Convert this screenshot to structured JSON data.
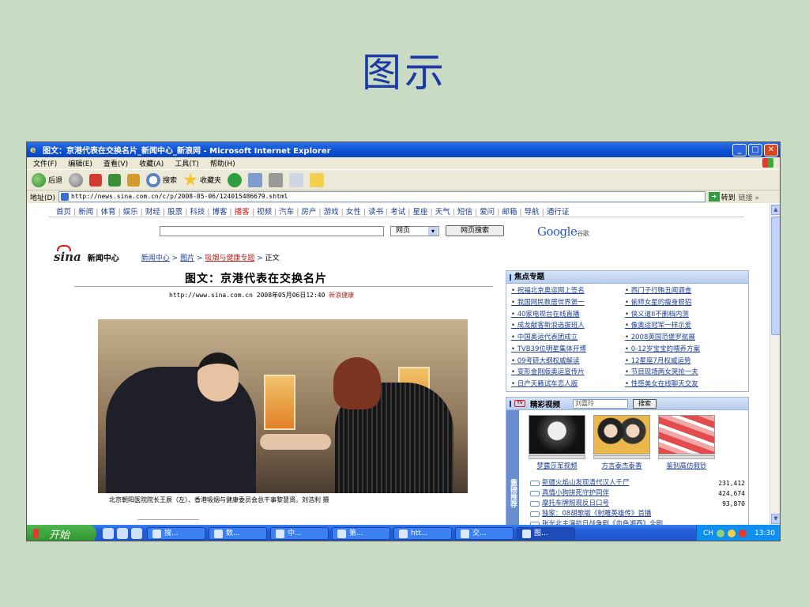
{
  "slide": {
    "title": "图示"
  },
  "window": {
    "title": "图文：京港代表在交换名片_新闻中心_新浪网 - Microsoft Internet Explorer",
    "minimize": "_",
    "maximize": "□",
    "close": "✕"
  },
  "menu": [
    "文件(F)",
    "编辑(E)",
    "查看(V)",
    "收藏(A)",
    "工具(T)",
    "帮助(H)"
  ],
  "toolbar": {
    "back": "后退",
    "search": "搜索",
    "favorites": "收藏夹"
  },
  "address": {
    "label": "地址(D)",
    "url": "http://news.sina.com.cn/c/p/2008-05-06/124015486679.shtml",
    "go": "转到",
    "links": "链接 »"
  },
  "site": {
    "nav": [
      "首页",
      "新闻",
      "体育",
      "娱乐",
      "财经",
      "股票",
      "科技",
      "博客",
      "播客",
      "视频",
      "汽车",
      "房产",
      "游戏",
      "女性",
      "读书",
      "考试",
      "星座",
      "天气",
      "短信",
      "爱问",
      "邮箱",
      "导航",
      "通行证"
    ],
    "hot_nav": "播客",
    "search_select": "网页",
    "search_button": "网页搜索",
    "google": "Google",
    "google_cn": "谷歌",
    "logo": "sina",
    "channel": "新闻中心",
    "breadcrumb": {
      "home": "新闻中心",
      "sep1": " > ",
      "section": "图片",
      "sep2": " > ",
      "topic": "吸烟与健康专题",
      "sep3": " > ",
      "current": "正文"
    }
  },
  "article": {
    "title": "图文：京港代表在交换名片",
    "url": "http://www.sina.com.cn",
    "date": "2008年05月06日12:40",
    "source": "新浪健康",
    "caption": "北京朝阳医院院长王辰（左）、香港吸烟与健康委员会总干事黎慧贤。刘浩利 摄"
  },
  "focus": {
    "header": "焦点专题",
    "items": [
      "祝福北京奥运网上签名",
      "西门子行贿丑闻调查",
      "我国网民数居世界第一",
      "偷师女星的瘦身狠招",
      "40家电视台在线直播",
      "侠义道II不删档内测",
      "成龙献客新浪选拔班人",
      "像奥运冠军一样示爱",
      "中国奥运代表团成立",
      "2008英国范堡罗航展",
      "TVB39位明星集体开博",
      "0-12岁宝宝的喂养方案",
      "09考研大纲权威解读",
      "12星座7月权威运势",
      "变形金刚版奥运宣传片",
      "节目现场两女哭抢一夫",
      "日产天籁试车恋人版",
      "性感美女在线聊天交友"
    ]
  },
  "video": {
    "header": "精彩视频",
    "tv_label": "TV",
    "search_value": "刘嘉玲",
    "search_button": "搜索",
    "side_label": "重磅推荐",
    "thumbs": [
      {
        "title": "梦露莎军视频"
      },
      {
        "title": "方言泰杰泰香"
      },
      {
        "title": "鉴别高仿假钞"
      }
    ],
    "list": [
      {
        "title": "新疆火焰山发现清代汉人千尸",
        "count": "231,412"
      },
      {
        "title": "真情小狗拼死守护同伴",
        "count": "424,674"
      },
      {
        "title": "摩托车牌照现反日口号",
        "count": "93,870"
      },
      {
        "title": "独家：08胡歌版《射雕英雄传》首播",
        "count": ""
      },
      {
        "title": "张光北主演抗日战争剧《血色湘西》全剧",
        "count": ""
      }
    ]
  },
  "taskbar": {
    "start": "开始",
    "tasks": [
      "搜...",
      "数...",
      "中...",
      "第...",
      "htt...",
      "交...",
      "图..."
    ],
    "tray_lang": "CH",
    "clock": "13:30"
  }
}
